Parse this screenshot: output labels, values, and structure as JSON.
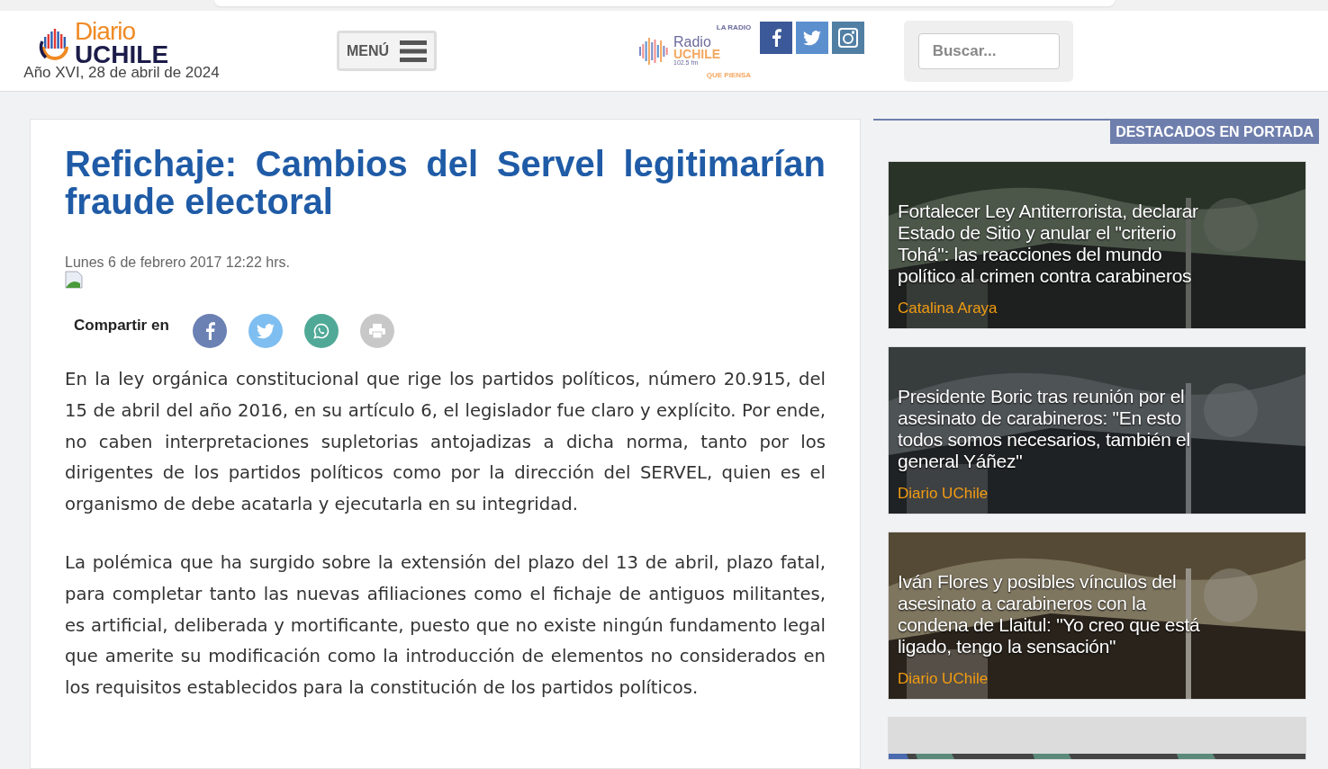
{
  "header": {
    "logo": {
      "top": "Diario",
      "bottom": "UCHILE"
    },
    "date": "Año XVI, 28 de abril de 2024",
    "menu_button": "MENÚ",
    "radio_logo": {
      "arc_top": "LA RADIO",
      "name": "Radio",
      "brand": "UCHILE",
      "frequency": "102.5 fm",
      "arc_bottom": "QUE PIENSA"
    },
    "social": [
      {
        "kind": "facebook",
        "color": "#3b5998"
      },
      {
        "kind": "twitter",
        "color": "#5b8fce"
      },
      {
        "kind": "instagram",
        "color": "#517fa4"
      }
    ],
    "search": {
      "placeholder": "Buscar..."
    }
  },
  "article": {
    "title": "Refichaje: Cambios del Servel legitimarían fraude electoral",
    "date": "Lunes 6 de febrero 2017 12:22 hrs.",
    "share_label": "Compartir en",
    "share_buttons": [
      {
        "kind": "facebook",
        "color": "#6b80b3"
      },
      {
        "kind": "twitter",
        "color": "#7fbef0"
      },
      {
        "kind": "whatsapp",
        "color": "#4fa996"
      },
      {
        "kind": "print",
        "color": "#c8c8c8"
      }
    ],
    "paragraphs": [
      "En la ley orgánica constitucional que rige los partidos políticos, número 20.915, del 15 de abril del año 2016, en su artículo 6, el legislador fue claro y explícito. Por ende, no caben interpretaciones supletorias antojadizas  a dicha norma, tanto por los dirigentes de los partidos políticos como por la dirección del SERVEL, quien es el organismo de debe acatarla y ejecutarla en su integridad.",
      "La polémica que ha surgido sobre la extensión del plazo del 13 de abril, plazo fatal, para completar tanto las nuevas afiliaciones como el fichaje de antiguos militantes, es artificial, deliberada y mortificante, puesto que no existe ningún fundamento legal que amerite su modificación como la introducción de elementos no considerados en los requisitos establecidos para la constitución de los partidos políticos."
    ]
  },
  "sidebar": {
    "heading": "DESTACADOS EN PORTADA",
    "cards": [
      {
        "kind": "story",
        "title": "Fortalecer Ley Antiterrorista, declarar Estado de Sitio y anular el \"criterio Tohá\": las reacciones del mundo político al crimen contra carabineros",
        "author": "Catalina Araya"
      },
      {
        "kind": "story",
        "title": "Presidente Boric tras reunión por el asesinato de carabineros: \"En esto todos somos necesarios, también el general Yáñez\"",
        "author": "Diario UChile"
      },
      {
        "kind": "story",
        "title": "Iván Flores y posibles vínculos del asesinato a carabineros con la condena de Llaitul: \"Yo creo que está ligado, tengo la sensación\"",
        "author": "Diario UChile"
      },
      {
        "kind": "picture"
      }
    ]
  }
}
